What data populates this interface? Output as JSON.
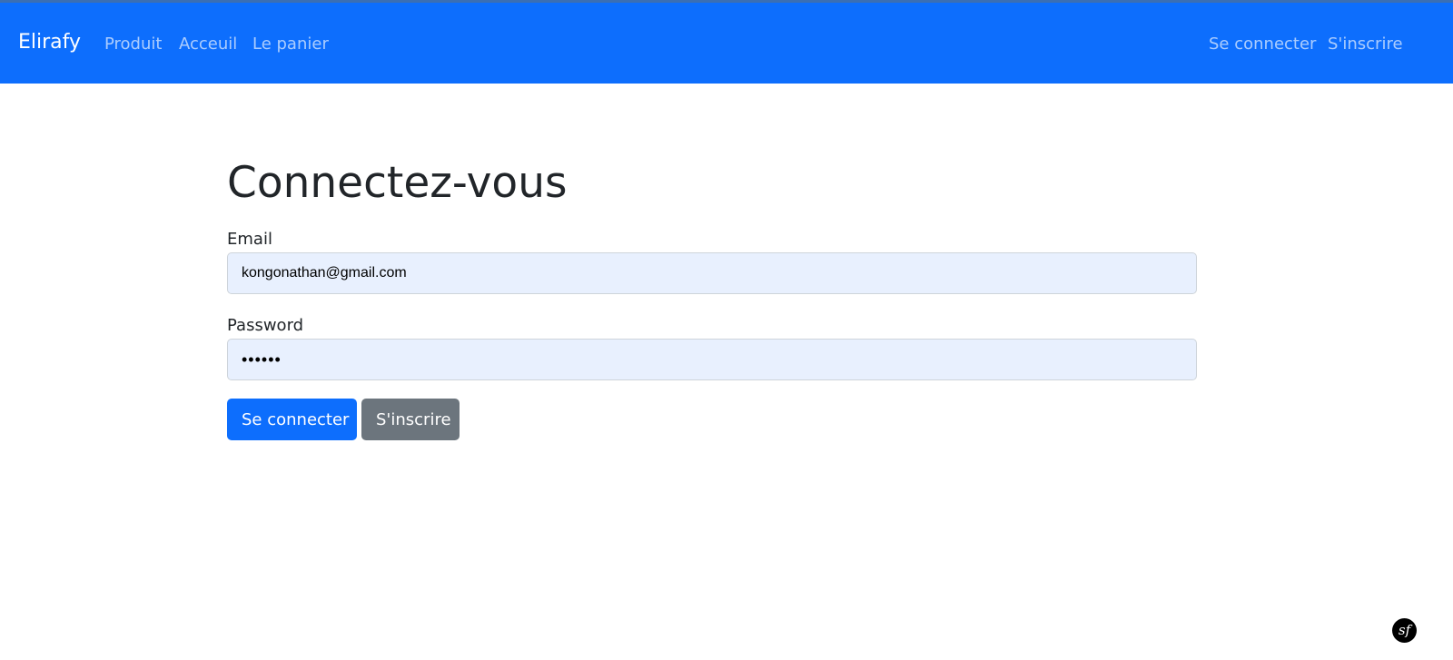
{
  "navbar": {
    "brand": "Elirafy",
    "links": [
      "Produit",
      "Acceuil",
      "Le panier"
    ],
    "right_links": [
      "Se connecter",
      "S'inscrire"
    ],
    "bg_color": "#0d6efd"
  },
  "form": {
    "title": "Connectez-vous",
    "email_label": "Email",
    "email_value": "kongonathan@gmail.com",
    "password_label": "Password",
    "password_value": "••••••",
    "submit_label": "Se connecter",
    "register_label": "S'inscrire"
  },
  "debug_toolbar": {
    "icon": "symfony-icon",
    "glyph": "sf"
  }
}
